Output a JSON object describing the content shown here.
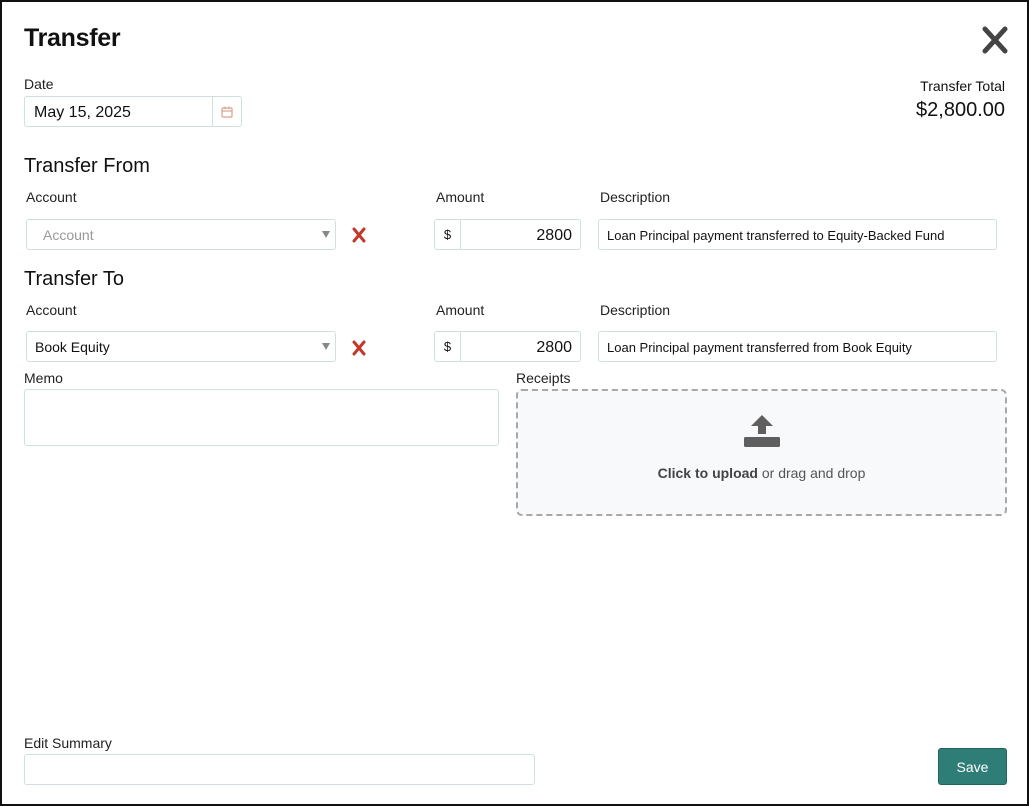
{
  "header": {
    "title": "Transfer"
  },
  "date": {
    "label": "Date",
    "value": "May 15, 2025"
  },
  "total": {
    "label": "Transfer Total",
    "value": "$2,800.00"
  },
  "transfer_from": {
    "heading": "Transfer From",
    "account_label": "Account",
    "account_placeholder": "Account",
    "amount_label": "Amount",
    "currency": "$",
    "amount": "2800",
    "description_label": "Description",
    "description": "Loan Principal payment transferred to Equity-Backed Fund"
  },
  "transfer_to": {
    "heading": "Transfer To",
    "account_label": "Account",
    "account_value": "Book Equity",
    "amount_label": "Amount",
    "currency": "$",
    "amount": "2800",
    "description_label": "Description",
    "description": "Loan Principal payment transferred from Book Equity"
  },
  "memo": {
    "label": "Memo"
  },
  "receipts": {
    "label": "Receipts",
    "upload_bold": "Click to upload",
    "upload_rest": " or drag and drop"
  },
  "edit_summary": {
    "label": "Edit Summary"
  },
  "actions": {
    "save": "Save"
  },
  "colors": {
    "accent": "#2f7d77",
    "remove": "#c0392b",
    "border": "#cfe0e0"
  },
  "icons": {
    "close": "close-icon",
    "calendar": "calendar-icon",
    "remove": "remove-x-icon",
    "upload": "upload-icon",
    "dropdown": "chevron-down-icon"
  }
}
